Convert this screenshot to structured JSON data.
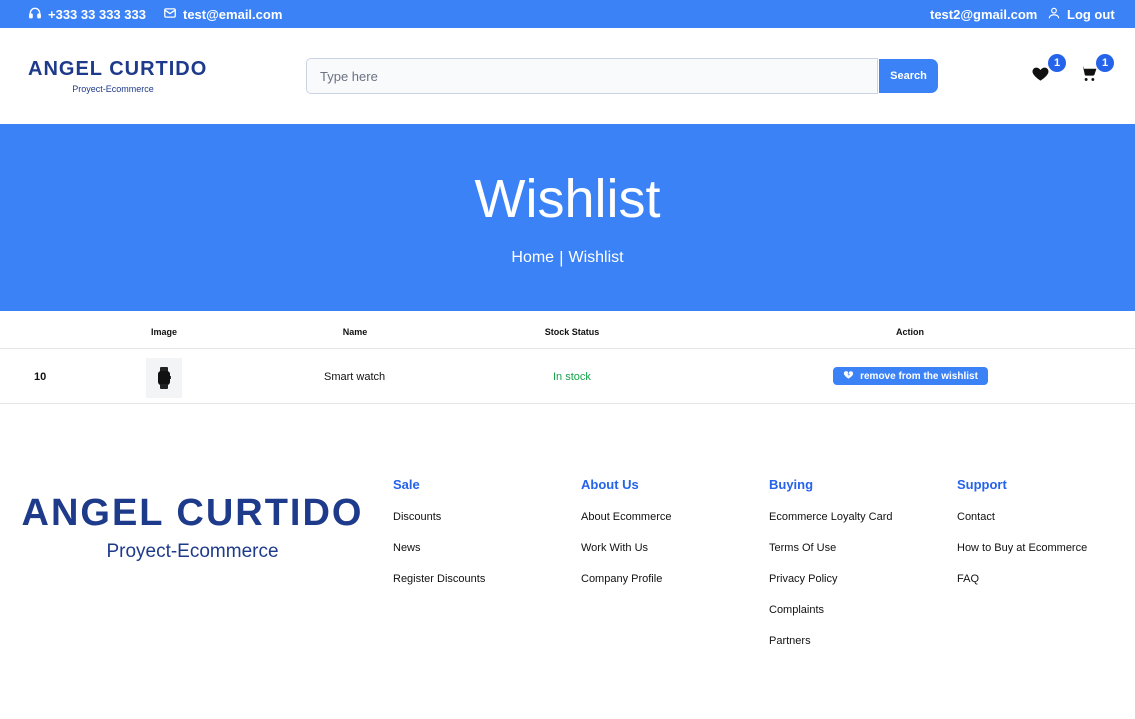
{
  "topbar": {
    "phone": "+333 33 333 333",
    "email": "test@email.com",
    "user_email": "test2@gmail.com",
    "logout": "Log out"
  },
  "header": {
    "logo_title": "ANGEL CURTIDO",
    "logo_sub": "Proyect-Ecommerce",
    "search_placeholder": "Type here",
    "search_button": "Search",
    "wishlist_count": "1",
    "cart_count": "1"
  },
  "hero": {
    "title": "Wishlist",
    "breadcrumb_home": "Home",
    "breadcrumb_sep": "|",
    "breadcrumb_current": "Wishlist"
  },
  "table": {
    "headers": [
      "Image",
      "Name",
      "Stock Status",
      "Action"
    ],
    "rows": [
      {
        "id": "10",
        "name": "Smart watch",
        "stock": "In stock",
        "action": "remove from the wishlist"
      }
    ]
  },
  "footer": {
    "logo_title": "ANGEL CURTIDO",
    "logo_sub": "Proyect-Ecommerce",
    "columns": [
      {
        "title": "Sale",
        "links": [
          "Discounts",
          "News",
          "Register Discounts"
        ]
      },
      {
        "title": "About Us",
        "links": [
          "About Ecommerce",
          "Work With Us",
          "Company Profile"
        ]
      },
      {
        "title": "Buying",
        "links": [
          "Ecommerce Loyalty Card",
          "Terms Of Use",
          "Privacy Policy",
          "Complaints",
          "Partners"
        ]
      },
      {
        "title": "Support",
        "links": [
          "Contact",
          "How to Buy at Ecommerce",
          "FAQ"
        ]
      }
    ]
  },
  "colors": {
    "primary": "#3b82f6",
    "brand_text": "#1e3a8a",
    "stock_ok": "#16a34a"
  }
}
